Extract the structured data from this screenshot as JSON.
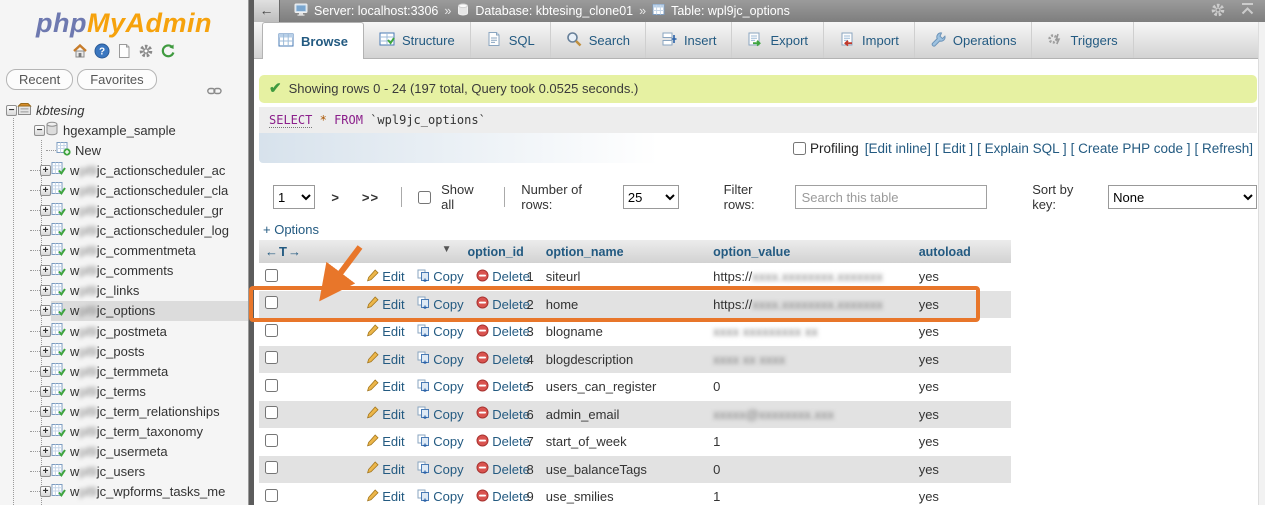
{
  "colors": {
    "accent_blue": "#235a81",
    "annotation_orange": "#e8762a",
    "success_bg": "#e6f1a2",
    "topbar_gray": "#8a8a8a",
    "row_alt_gray": "#e2e2e2",
    "selected_nav_gray": "#dcdcdc",
    "logo_php_blue": "#6e79b0",
    "logo_myadmin_orange": "#f6a20c"
  },
  "topbar": {
    "back_glyph": "←",
    "separator": "»",
    "crumbs": {
      "server": "Server: localhost:3306",
      "database": "Database: kbtesing_clone01",
      "table": "Table: wpl9jc_options"
    }
  },
  "tabs": [
    {
      "label": "Browse"
    },
    {
      "label": "Structure"
    },
    {
      "label": "SQL"
    },
    {
      "label": "Search"
    },
    {
      "label": "Insert"
    },
    {
      "label": "Export"
    },
    {
      "label": "Import"
    },
    {
      "label": "Operations"
    },
    {
      "label": "Triggers"
    }
  ],
  "message": {
    "icon": "✔",
    "text": "Showing rows 0 - 24 (197 total, Query took 0.0525 seconds.)"
  },
  "sql": {
    "kw_select": "SELECT",
    "star": "*",
    "kw_from": "FROM",
    "table": "`wpl9jc_options`"
  },
  "profiling": {
    "label": "Profiling",
    "links": [
      "[Edit inline]",
      "[ Edit ]",
      "[ Explain SQL ]",
      "[ Create PHP code ]",
      "[ Refresh]"
    ]
  },
  "pagination": {
    "page_value": "1",
    "next": ">",
    "last": ">>",
    "show_all": "Show all",
    "rows_label": "Number of rows:",
    "rows_value": "25",
    "filter_label": "Filter rows:",
    "filter_placeholder": "Search this table",
    "sort_label": "Sort by key:",
    "sort_value": "None"
  },
  "options_toggle": "+ Options",
  "table": {
    "header_controls": {
      "move": "←T→",
      "arrow": "▼"
    },
    "columns": [
      "option_id",
      "option_name",
      "option_value",
      "autoload"
    ],
    "actions": {
      "edit": "Edit",
      "copy": "Copy",
      "delete": "Delete"
    },
    "rows": [
      {
        "option_id": "1",
        "option_name": "siteurl",
        "value": {
          "prefix": "https://",
          "blurred": "xxxx.xxxxxxxx.xxxxxxx"
        },
        "autoload": "yes"
      },
      {
        "option_id": "2",
        "option_name": "home",
        "value": {
          "prefix": "https://",
          "blurred": "xxxx.xxxxxxxx.xxxxxxx"
        },
        "autoload": "yes",
        "highlighted": true
      },
      {
        "option_id": "3",
        "option_name": "blogname",
        "value": {
          "blurred": "xxxx xxxxxxxxx xx"
        },
        "autoload": "yes"
      },
      {
        "option_id": "4",
        "option_name": "blogdescription",
        "value": {
          "blurred": "xxxx xx xxxx"
        },
        "autoload": "yes"
      },
      {
        "option_id": "5",
        "option_name": "users_can_register",
        "value": {
          "plain": "0"
        },
        "autoload": "yes"
      },
      {
        "option_id": "6",
        "option_name": "admin_email",
        "value": {
          "blurred": "xxxxx@xxxxxxxx.xxx"
        },
        "autoload": "yes"
      },
      {
        "option_id": "7",
        "option_name": "start_of_week",
        "value": {
          "plain": "1"
        },
        "autoload": "yes"
      },
      {
        "option_id": "8",
        "option_name": "use_balanceTags",
        "value": {
          "plain": "0"
        },
        "autoload": "yes"
      },
      {
        "option_id": "9",
        "option_name": "use_smilies",
        "value": {
          "plain": "1"
        },
        "autoload": "yes"
      }
    ]
  },
  "annotation": {
    "highlighted_option_id": "2"
  },
  "sidebar": {
    "logo_php": "php",
    "logo_myadmin": "MyAdmin",
    "buttons": {
      "recent": "Recent",
      "favorites": "Favorites"
    },
    "tree": {
      "collapse_glyph": "−",
      "expand_glyph": "+",
      "server": "kbtesing",
      "database": "hgexample_sample",
      "new": "New",
      "table_prefix_visible": "w",
      "table_prefix_redacted": "pl9",
      "tables": [
        {
          "suffix": "jc_actionscheduler_ac"
        },
        {
          "suffix": "jc_actionscheduler_cla"
        },
        {
          "suffix": "jc_actionscheduler_gr"
        },
        {
          "suffix": "jc_actionscheduler_log"
        },
        {
          "suffix": "jc_commentmeta"
        },
        {
          "suffix": "jc_comments"
        },
        {
          "suffix": "jc_links"
        },
        {
          "suffix": "jc_options",
          "selected": true
        },
        {
          "suffix": "jc_postmeta"
        },
        {
          "suffix": "jc_posts"
        },
        {
          "suffix": "jc_termmeta"
        },
        {
          "suffix": "jc_terms"
        },
        {
          "suffix": "jc_term_relationships"
        },
        {
          "suffix": "jc_term_taxonomy"
        },
        {
          "suffix": "jc_usermeta"
        },
        {
          "suffix": "jc_users"
        },
        {
          "suffix": "jc_wpforms_tasks_me"
        }
      ]
    }
  }
}
